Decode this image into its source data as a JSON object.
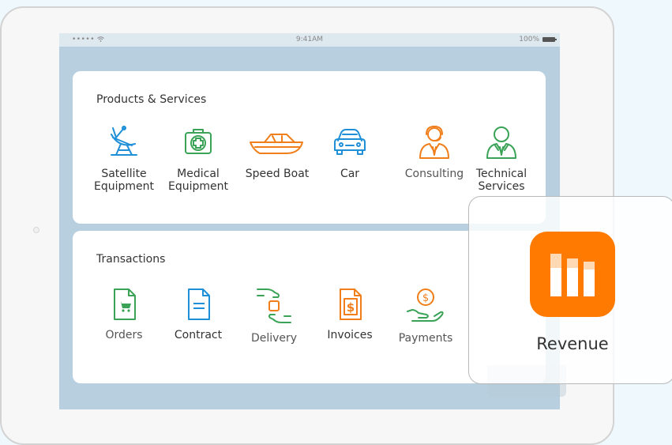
{
  "status_bar": {
    "signal": "•••••",
    "time": "9:41AM",
    "battery": "100%"
  },
  "products": {
    "title": "Products & Services",
    "items": [
      {
        "line1": "Satellite",
        "line2": "Equipment",
        "icon": "satellite-dish-icon"
      },
      {
        "line1": "Medical",
        "line2": "Equipment",
        "icon": "medical-kit-icon"
      },
      {
        "line1": "Speed Boat",
        "line2": "",
        "icon": "speed-boat-icon"
      },
      {
        "line1": "Car",
        "line2": "",
        "icon": "car-icon"
      },
      {
        "line1": "Consulting",
        "line2": "",
        "icon": "consultant-icon"
      },
      {
        "line1": "Technical",
        "line2": "Services",
        "icon": "technician-icon"
      }
    ]
  },
  "transactions": {
    "title": "Transactions",
    "items": [
      {
        "label": "Orders",
        "icon": "shopping-cart-document-icon"
      },
      {
        "label": "Contract",
        "icon": "contract-document-icon"
      },
      {
        "label": "Delivery",
        "icon": "delivery-hands-icon"
      },
      {
        "label": "Invoices",
        "icon": "invoice-dollar-icon"
      },
      {
        "label": "Payments",
        "icon": "payment-coin-hand-icon"
      }
    ]
  },
  "revenue": {
    "label": "Revenue",
    "icon": "revenue-bars-icon"
  },
  "colors": {
    "blue": "#1f8fd8",
    "green": "#3aa357",
    "orange": "#f07e1a",
    "revenue_orange": "#ff7a00"
  }
}
